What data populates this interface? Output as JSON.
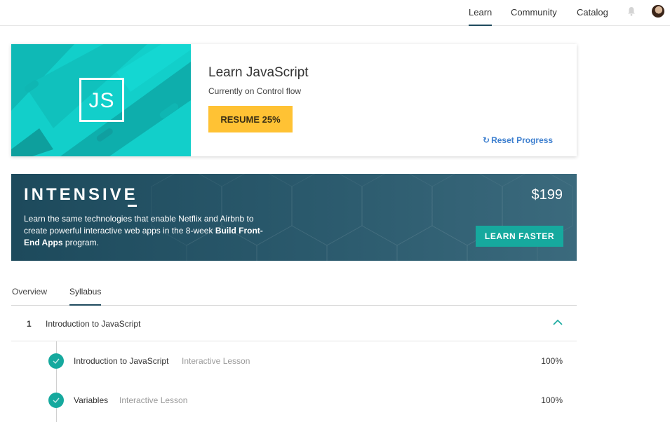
{
  "nav": {
    "items": [
      {
        "label": "Learn",
        "active": true
      },
      {
        "label": "Community",
        "active": false
      },
      {
        "label": "Catalog",
        "active": false
      }
    ],
    "icons": [
      "bell-icon",
      "avatar"
    ]
  },
  "course": {
    "logo_text": "JS",
    "title": "Learn JavaScript",
    "subtitle": "Currently on Control flow",
    "resume_label": "RESUME 25%",
    "progress": 0.25,
    "reset_label": "Reset Progress",
    "hero_color": "#12cfca",
    "resume_color": "#ffc234"
  },
  "intensive": {
    "title": "INTENSIVE",
    "desc_part1": "Learn the same technologies that enable Netflix and Airbnb to create powerful interactive web apps in the 8-week ",
    "desc_bold": "Build Front-End Apps",
    "desc_part2": " program.",
    "price": "$199",
    "cta_label": "LEARN FASTER",
    "cta_color": "#16a99e"
  },
  "tabs": [
    {
      "label": "Overview",
      "active": false
    },
    {
      "label": "Syllabus",
      "active": true
    }
  ],
  "syllabus": {
    "module": {
      "number": "1",
      "title": "Introduction to JavaScript",
      "expanded": true
    },
    "lessons": [
      {
        "title": "Introduction to JavaScript",
        "type": "Interactive Lesson",
        "percent": "100%",
        "complete": true
      },
      {
        "title": "Variables",
        "type": "Interactive Lesson",
        "percent": "100%",
        "complete": true
      }
    ]
  }
}
